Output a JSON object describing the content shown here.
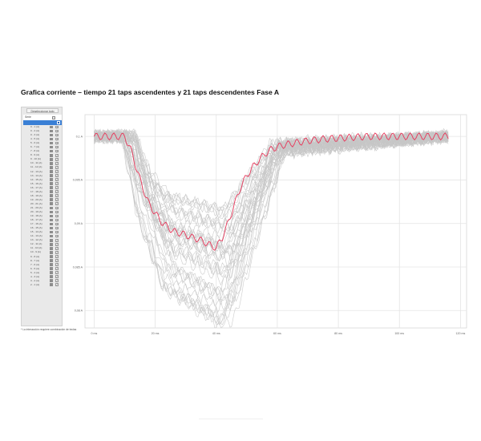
{
  "title": "Grafica corriente – tiempo 21 taps ascendentes y 21 taps descendentes Fase A",
  "sidebar": {
    "deselect_label": "Deseleccionar todo",
    "header_label": "Serie",
    "items": [
      "0 - 1 (A)",
      "0 - 2 (A)",
      "0 - 3 (A)",
      "4 - 5 (A)",
      "5 - 6 (A)",
      "6 - 7 (A)",
      "7 - 8 (A)",
      "8 - 9 (A)",
      "9 - 10 (A)",
      "10 - 11 (A)",
      "11 - 12 (A)",
      "12 - 13 (A)",
      "13 - 14 (A)",
      "14 - 15 (A)",
      "15 - 16 (A)",
      "16 - 17 (A)",
      "17 - 18 (A)",
      "18 - 19 (A)",
      "19 - 20 (A)",
      "20 - 21 (A)",
      "21 - 20 (A)",
      "20 - 19 (A)",
      "19 - 18 (A)",
      "18 - 17 (A)",
      "17 - 16 (A)",
      "16 - 15 (A)",
      "15 - 14 (A)",
      "14 - 13 (A)",
      "13 - 12 (A)",
      "12 - 11 (A)",
      "11 - 10 (A)",
      "10 - 9 (A)",
      "9 - 8 (A)",
      "8 - 7 (A)",
      "7 - 6 (A)",
      "6 - 5 (A)",
      "5 - 4 (A)",
      "4 - 3 (A)",
      "3 - 2 (A)",
      "2 - 1 (A)"
    ],
    "check_glyph": "✓"
  },
  "note": "* La interacción requiere combinación de teclas",
  "colors": {
    "highlight": "#e8375a",
    "series": "#c6c6c6",
    "grid": "#e4e4e4",
    "selected_row": "#3a7fd5"
  },
  "chart_data": {
    "type": "line",
    "title": "Grafica corriente – tiempo 21 taps ascendentes y 21 taps descendentes Fase A",
    "xlabel": "",
    "ylabel": "",
    "x_ticks": [
      "0 ms",
      "20 ms",
      "40 ms",
      "60 ms",
      "80 ms",
      "100 ms",
      "120 ms"
    ],
    "x_tick_values": [
      0,
      20,
      40,
      60,
      80,
      100,
      120
    ],
    "y_ticks": [
      "0,1 A",
      "0,095 A",
      "0,09 A",
      "0,085 A",
      "0,08 A"
    ],
    "y_tick_values": [
      0.1,
      0.095,
      0.09,
      0.085,
      0.08
    ],
    "xlim": [
      -3,
      122
    ],
    "ylim": [
      0.078,
      0.1025
    ],
    "grid": true,
    "legend": "none",
    "highlight_series": {
      "x": [
        0,
        5,
        10,
        12,
        14,
        16,
        18,
        20,
        22,
        24,
        26,
        28,
        30,
        32,
        34,
        36,
        38,
        40,
        42,
        44,
        46,
        48,
        50,
        52,
        54,
        56,
        58,
        60,
        62,
        65,
        70,
        75,
        80,
        85,
        90,
        95,
        100,
        105,
        110,
        115,
        116
      ],
      "y": [
        0.1,
        0.1,
        0.1,
        0.0985,
        0.0962,
        0.094,
        0.0922,
        0.0912,
        0.0902,
        0.0896,
        0.0891,
        0.0889,
        0.0887,
        0.0884,
        0.0882,
        0.0879,
        0.0875,
        0.0872,
        0.0884,
        0.0902,
        0.0922,
        0.0942,
        0.0955,
        0.0965,
        0.0973,
        0.098,
        0.0985,
        0.0988,
        0.099,
        0.0992,
        0.0995,
        0.0997,
        0.0998,
        0.0999,
        0.1,
        0.1,
        0.1,
        0.1,
        0.1,
        0.1,
        0.1
      ]
    },
    "background_series_count": 41
  }
}
